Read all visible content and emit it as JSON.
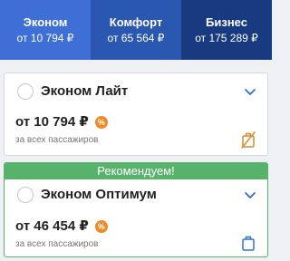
{
  "tabs": [
    {
      "name": "Эконом",
      "price": "от 10 794 ₽"
    },
    {
      "name": "Комфорт",
      "price": "от 65 564 ₽"
    },
    {
      "name": "Бизнес",
      "price": "от 175 289 ₽"
    }
  ],
  "colors": {
    "tab_econom": "#3d6fd6",
    "tab_comfort": "#2a57b0",
    "tab_business": "#173a80",
    "recommended": "#57b36b",
    "discount_badge": "#f08a24",
    "baggage_crossed": "#d98a2b",
    "baggage": "#2f6ed8"
  },
  "cards": [
    {
      "title": "Эконом Лайт",
      "price": "от 10 794 ₽",
      "badge": "%",
      "note": "за всех пассажиров",
      "baggage_icon": "no-baggage-icon"
    },
    {
      "banner": "Рекомендуем!",
      "title": "Эконом Оптимум",
      "price": "от 46 454 ₽",
      "badge": "%",
      "note": "за всех пассажиров",
      "baggage_icon": "baggage-icon"
    }
  ]
}
